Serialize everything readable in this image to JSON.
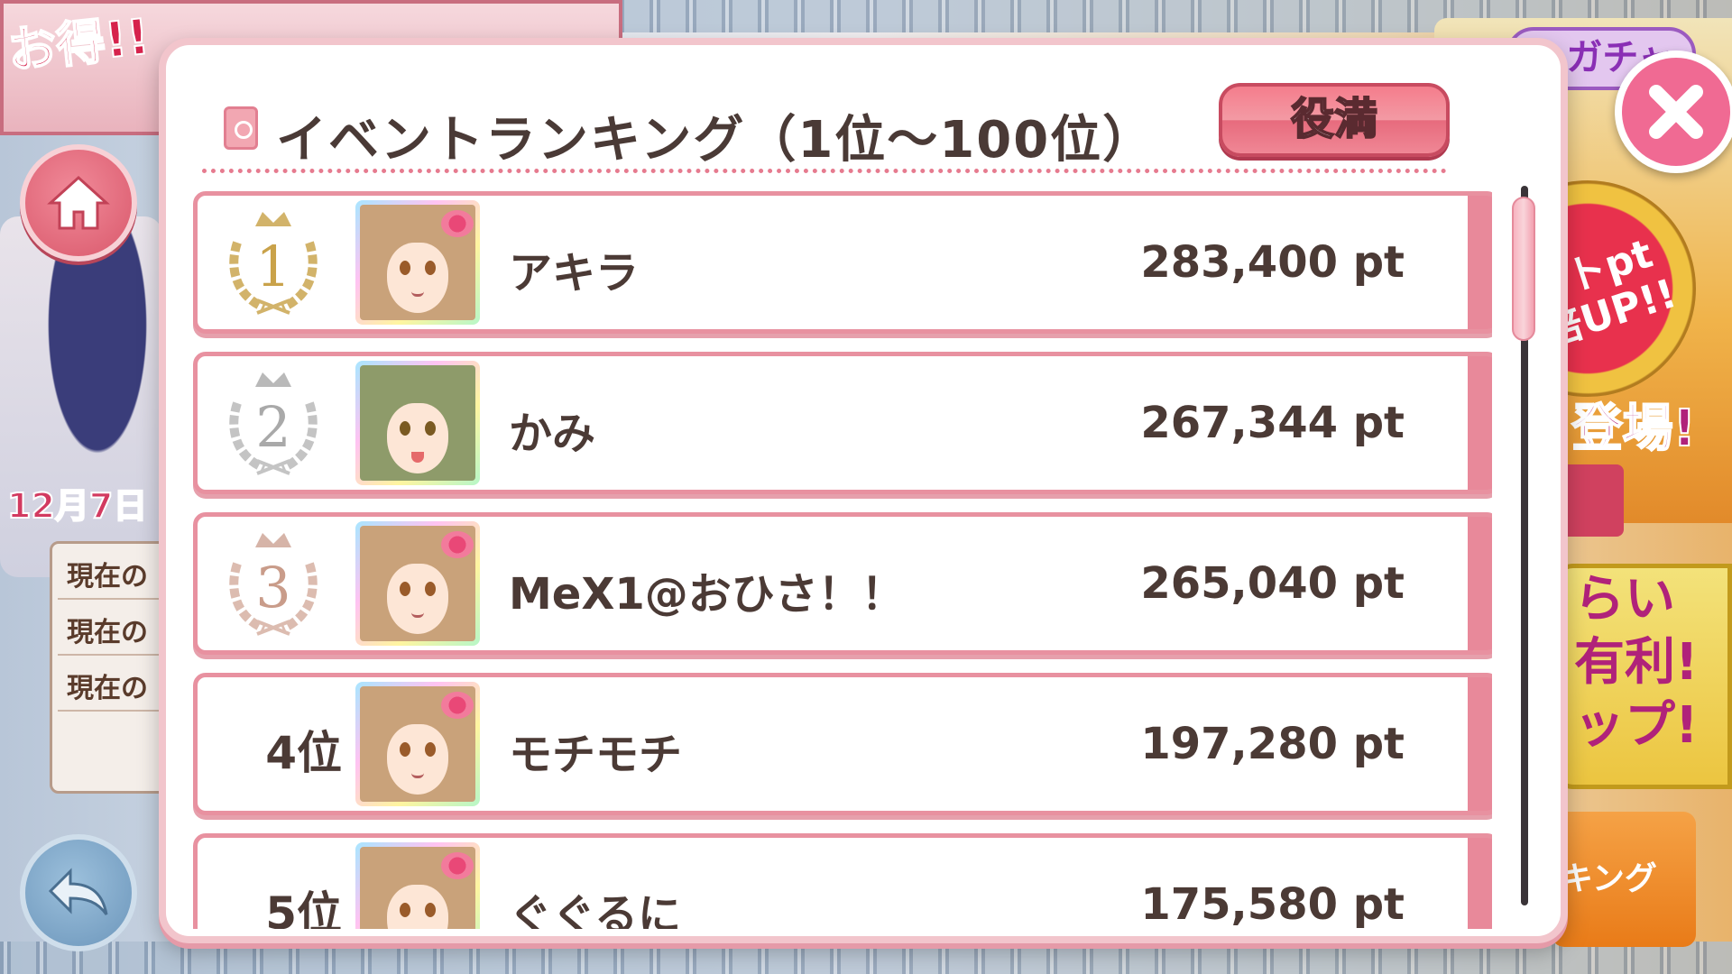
{
  "background": {
    "banner_text": "お得!!",
    "date_text": "12月7日",
    "info_rows": [
      "現在の",
      "現在の",
      "現在の"
    ],
    "gacha_tag": "ガチャ",
    "medal_text": "ントpt 倍UP!!",
    "tojo_text": "登場!",
    "promo_text": "らい 有利! ップ!",
    "ranking_button_text": "キング"
  },
  "modal": {
    "title": "イベントランキング（1位～100位）",
    "toggle_label": "役満",
    "close_icon": "close-icon",
    "accent_color": "#e891a0"
  },
  "ranking": {
    "rows": [
      {
        "rank": "1",
        "rank_style": "gold-crown",
        "name": "アキラ",
        "points": "283,400 pt",
        "avatar": "brown-hair-flower"
      },
      {
        "rank": "2",
        "rank_style": "silver-crown",
        "name": "かみ",
        "points": "267,344 pt",
        "avatar": "green-hair"
      },
      {
        "rank": "3",
        "rank_style": "bronze-crown",
        "name": "MeX1@おひさ！！",
        "points": "265,040 pt",
        "avatar": "brown-hair-flower"
      },
      {
        "rank": "4位",
        "rank_style": "text",
        "name": "モチモチ",
        "points": "197,280 pt",
        "avatar": "brown-hair-flower"
      },
      {
        "rank": "5位",
        "rank_style": "text",
        "name": "ぐぐるに",
        "points": "175,580 pt",
        "avatar": "brown-hair-flower"
      }
    ],
    "scroll_position": 0.0
  }
}
